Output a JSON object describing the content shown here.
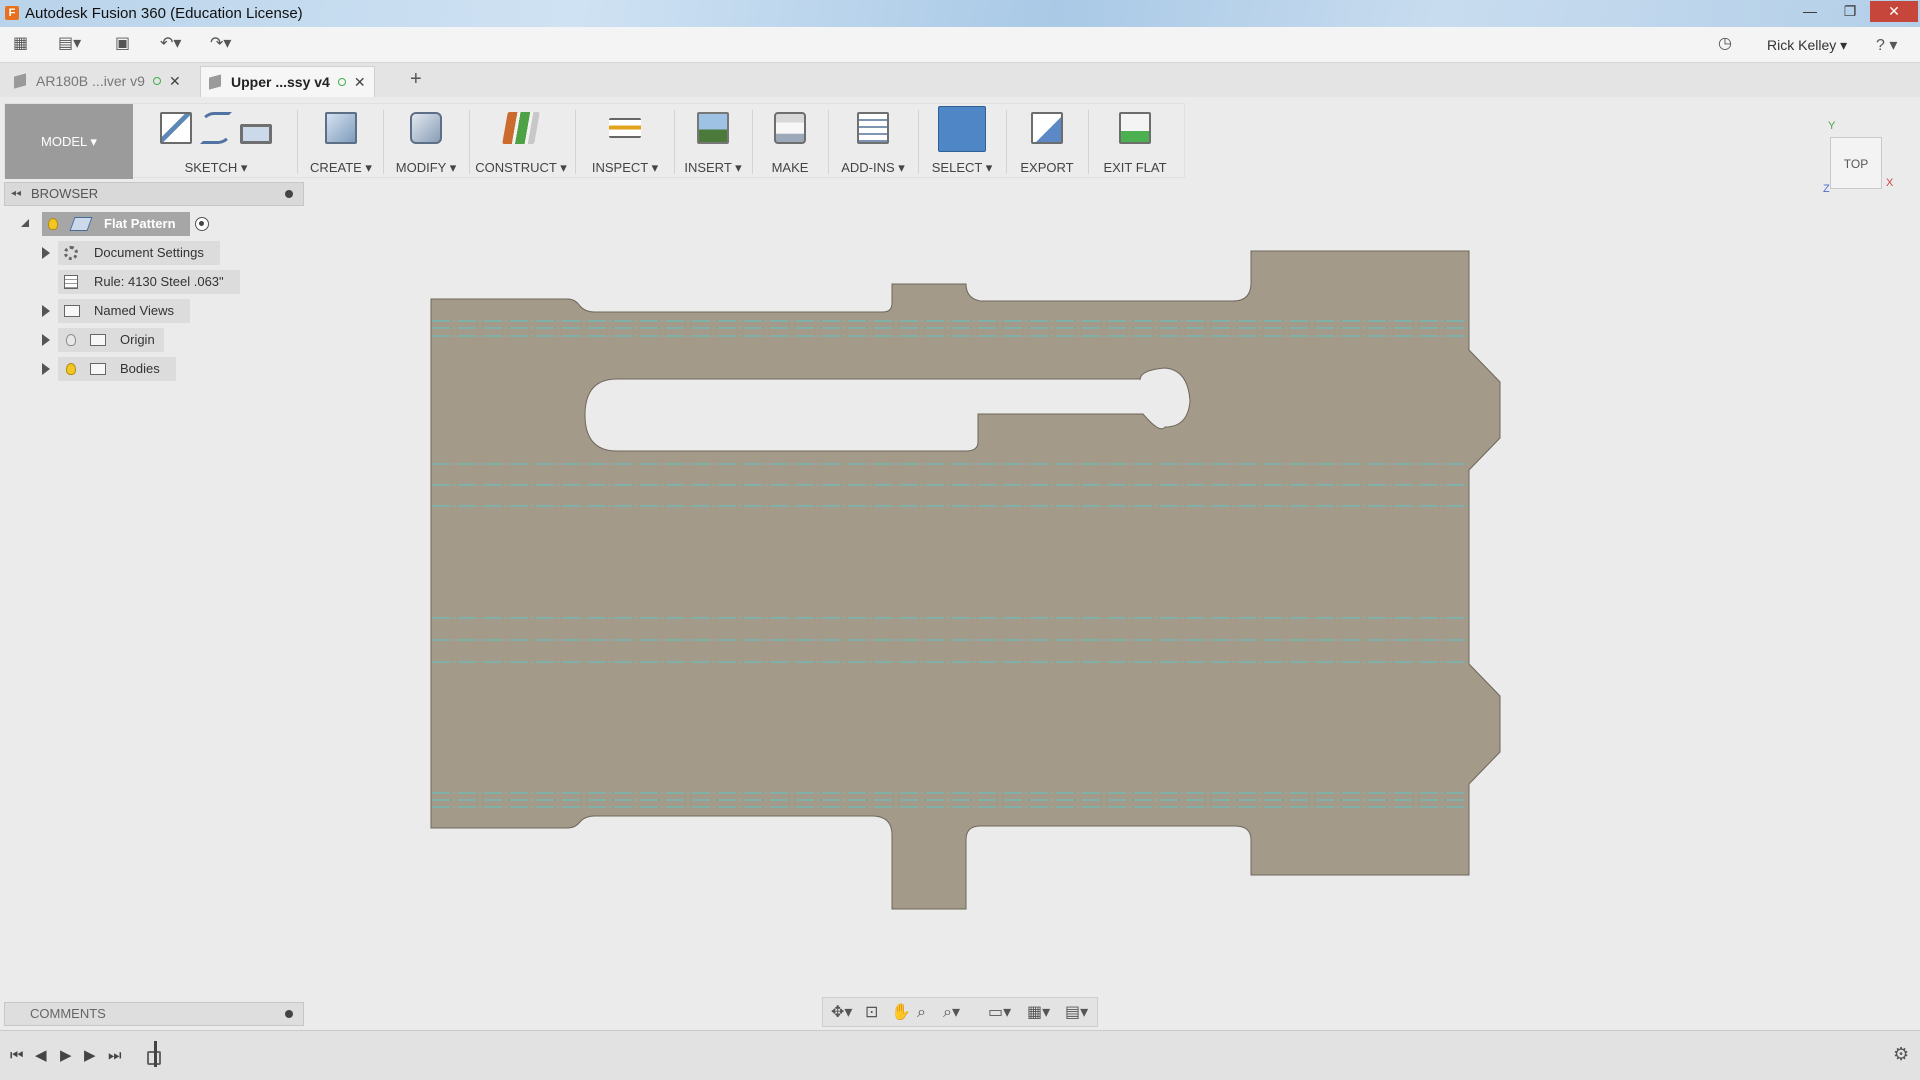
{
  "window": {
    "title": "Autodesk Fusion 360 (Education License)",
    "minimize_label": "—",
    "maximize_label": "❐",
    "close_label": "✕"
  },
  "quickaccess": {
    "user": "Rick Kelley ▾",
    "help": "? ▾",
    "icons": [
      "grid-icon",
      "file-icon",
      "save-icon",
      "undo-icon",
      "redo-icon",
      "clock-icon"
    ]
  },
  "tabs": [
    {
      "label": "AR180B ...iver v9",
      "active": false
    },
    {
      "label": "Upper ...ssy v4",
      "active": true
    }
  ],
  "toolbar": {
    "mode": "MODEL ▾",
    "groups": {
      "sketch": "SKETCH ▾",
      "create": "CREATE ▾",
      "modify": "MODIFY ▾",
      "construct": "CONSTRUCT ▾",
      "inspect": "INSPECT ▾",
      "insert": "INSERT ▾",
      "make": "MAKE",
      "addins": "ADD-INS ▾",
      "select": "SELECT ▾",
      "export": "EXPORT",
      "exitflat": "EXIT FLAT"
    }
  },
  "browser": {
    "title": "BROWSER",
    "root": "Flat Pattern",
    "items": [
      {
        "label": "Document Settings",
        "icon": "gear-icon"
      },
      {
        "label": "Rule: 4130 Steel .063\"",
        "icon": "rule-icon"
      },
      {
        "label": "Named Views",
        "icon": "folder-icon"
      },
      {
        "label": "Origin",
        "icon": "folder-icon"
      },
      {
        "label": "Bodies",
        "icon": "folder-icon"
      }
    ]
  },
  "viewcube": {
    "face": "TOP",
    "axis_x": "X",
    "axis_y": "Y",
    "axis_z": "Z"
  },
  "comments": {
    "title": "COMMENTS"
  },
  "navbar": {
    "icons": [
      "orbit-icon",
      "look-at-icon",
      "pan-icon",
      "zoom-icon",
      "fit-icon",
      "display-settings-icon",
      "grid-settings-icon",
      "viewports-icon"
    ]
  },
  "colors": {
    "part_fill": "#a39a89",
    "bend_line": "#5cc6c6",
    "select_active": "#4f86c6",
    "canvas_bg": "#ebebeb"
  }
}
